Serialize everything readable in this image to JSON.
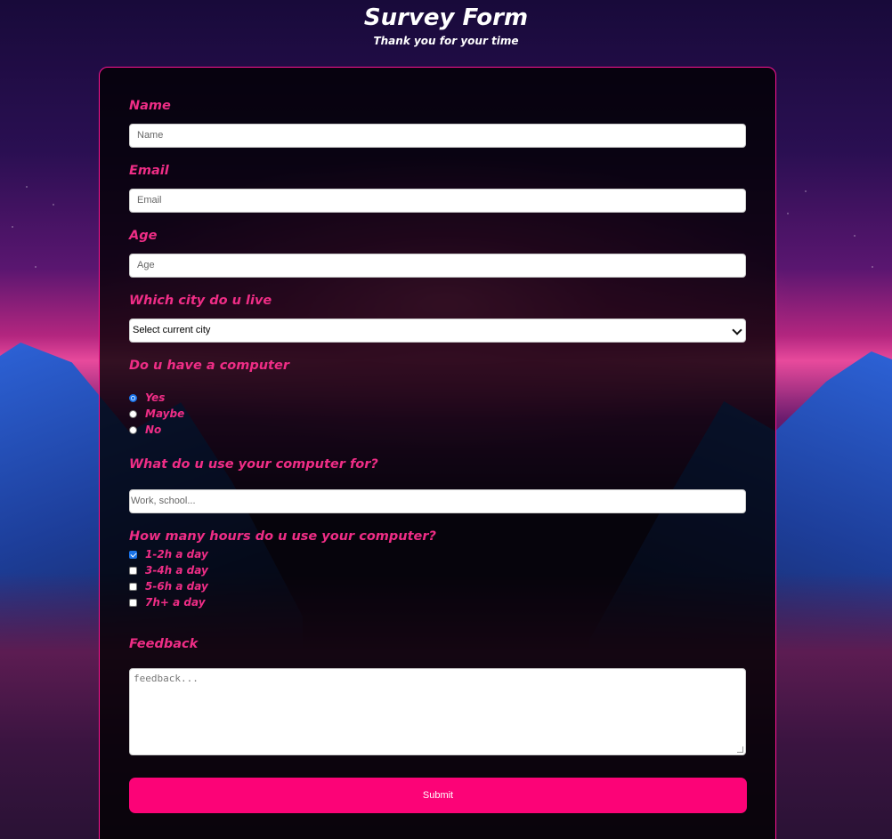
{
  "header": {
    "title": "Survey Form",
    "subtitle": "Thank you for your time"
  },
  "form": {
    "name": {
      "label": "Name",
      "placeholder": "Name"
    },
    "email": {
      "label": "Email",
      "placeholder": "Email"
    },
    "age": {
      "label": "Age",
      "placeholder": "Age"
    },
    "city": {
      "label": "Which city do u live",
      "selected": "Select current city"
    },
    "computer": {
      "label": "Do u have a computer",
      "options": [
        "Yes",
        "Maybe",
        "No"
      ],
      "checked": "Yes"
    },
    "usage": {
      "label": "What do u use your computer for?",
      "placeholder": "Work, school..."
    },
    "hours": {
      "label": "How many hours do u use your computer?",
      "options": [
        "1-2h a day",
        "3-4h a day",
        "5-6h a day",
        "7h+ a day"
      ],
      "checked": [
        "1-2h a day"
      ]
    },
    "feedback": {
      "label": "Feedback",
      "placeholder": "feedback..."
    },
    "submit_label": "Submit"
  },
  "colors": {
    "accent": "#fc0377",
    "label": "#ef2d86",
    "card_border": "#ff1493",
    "check": "#1a73e8"
  }
}
